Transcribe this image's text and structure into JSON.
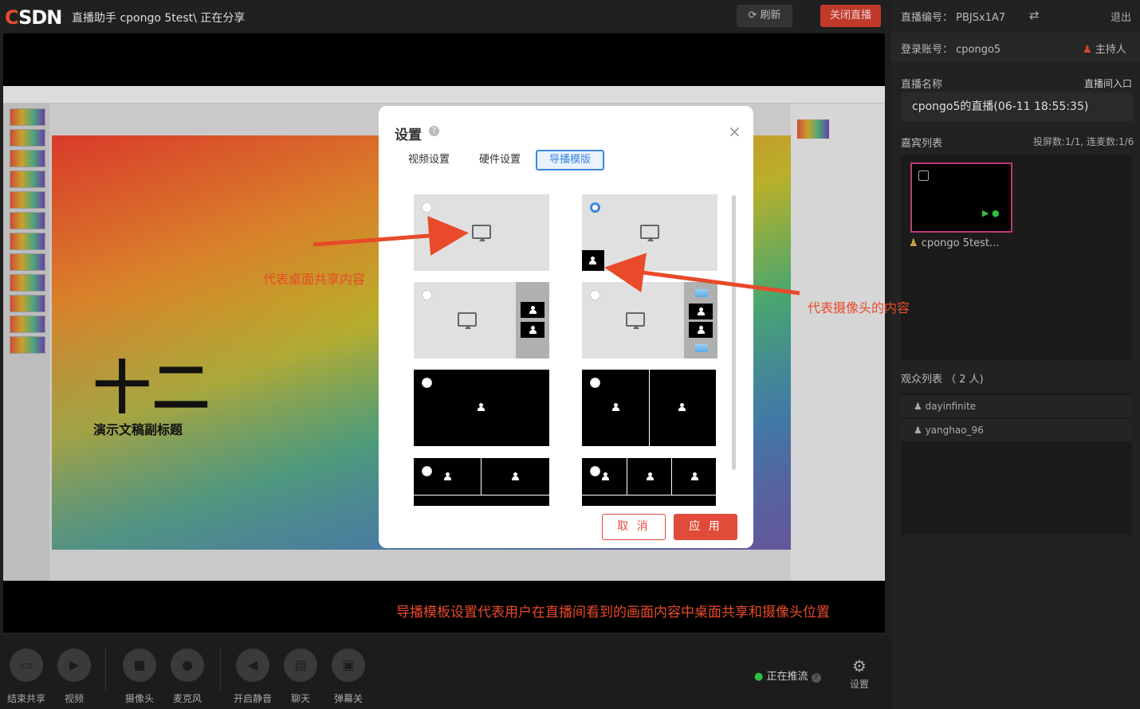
{
  "topbar": {
    "logo": "CSDN",
    "title": "直播助手 cpongo 5test\\ 正在分享",
    "refresh_label": "刷新",
    "close_live_label": "关闭直播"
  },
  "slide": {
    "title": "十二",
    "subtitle": "演示文稿副标题"
  },
  "annotations": {
    "left": "代表桌面共享内容",
    "right": "代表摄像头的内容",
    "caption": "导播模板设置代表用户在直播间看到的画面内容中桌面共享和摄像头位置"
  },
  "dialog": {
    "title": "设置",
    "tabs": [
      "视频设置",
      "硬件设置",
      "导播模版"
    ],
    "active_tab": "导播模版",
    "selected_template": 2,
    "cancel_label": "取 消",
    "apply_label": "应 用"
  },
  "sidebar": {
    "live_id": "直播编号：  PBJSx1A7",
    "logout": "退出",
    "account": "登录账号：  cpongo5",
    "host": "主持人",
    "stream_name_label": "直播名称",
    "entry_link": "直播间入口",
    "stream_name": "cpongo5的直播(06-11 18:55:35)",
    "guests_label": "嘉宾列表",
    "guests_stats": "投屏数:1/1,  连麦数:1/6",
    "guest_name": "cpongo 5test...",
    "audience_label": "观众列表 （ 2 人)",
    "audience": [
      "dayinfinite",
      "yanghao_96"
    ]
  },
  "bottombar": {
    "controls": [
      "结束共享",
      "视频",
      "摄像头",
      "麦克风",
      "开启静音",
      "聊天",
      "弹幕关"
    ],
    "push_status": "正在推流",
    "settings": "设置"
  },
  "colors": {
    "accent": "#e04b3a",
    "tab_active": "#3b87e0",
    "annotation": "#e84a2a"
  }
}
